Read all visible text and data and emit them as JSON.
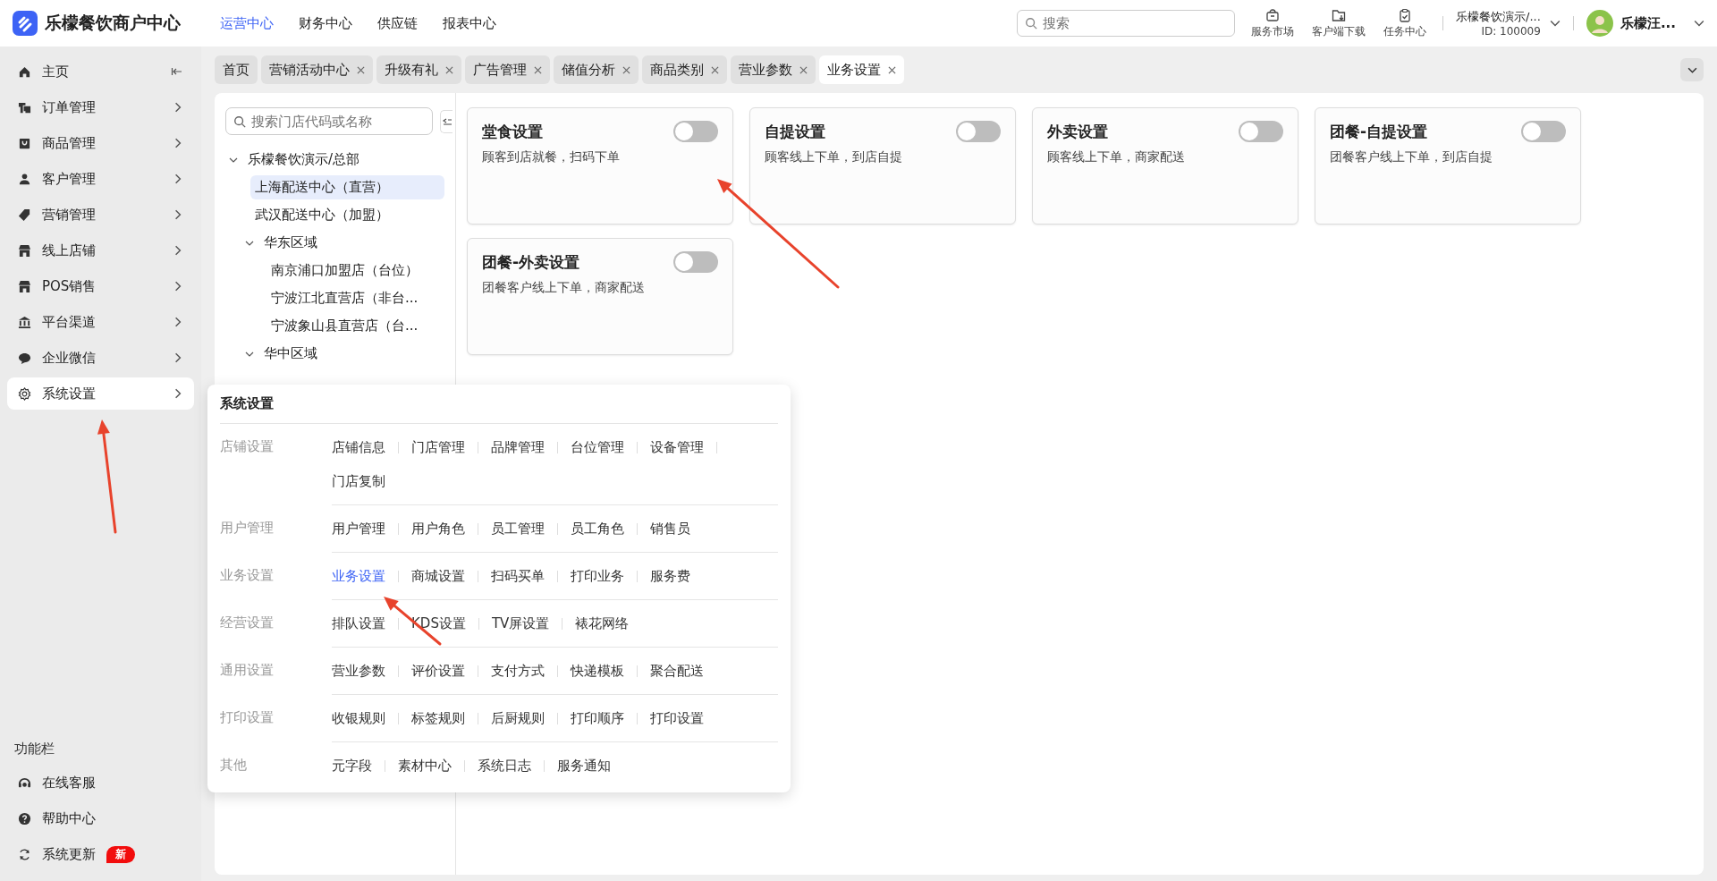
{
  "app": {
    "title": "乐檬餐饮商户中心"
  },
  "top_nav": [
    {
      "label": "运营中心",
      "selected": true
    },
    {
      "label": "财务中心",
      "selected": false
    },
    {
      "label": "供应链",
      "selected": false
    },
    {
      "label": "报表中心",
      "selected": false
    }
  ],
  "search": {
    "placeholder": "搜索"
  },
  "toolbar": [
    {
      "label": "服务市场",
      "kind": "market"
    },
    {
      "label": "客户端下载",
      "kind": "download"
    },
    {
      "label": "任务中心",
      "kind": "tasks"
    }
  ],
  "org": {
    "name": "乐檬餐饮演示/...",
    "id": "ID: 100009"
  },
  "user": {
    "name": "乐檬汪..."
  },
  "sidebar": {
    "items": [
      {
        "label": "主页",
        "selected": false,
        "kind": "collapse"
      },
      {
        "label": "订单管理",
        "selected": false,
        "kind": "menu"
      },
      {
        "label": "商品管理",
        "selected": false,
        "kind": "menu"
      },
      {
        "label": "客户管理",
        "selected": false,
        "kind": "menu"
      },
      {
        "label": "营销管理",
        "selected": false,
        "kind": "menu"
      },
      {
        "label": "线上店铺",
        "selected": false,
        "kind": "menu"
      },
      {
        "label": "POS销售",
        "selected": false,
        "kind": "menu"
      },
      {
        "label": "平台渠道",
        "selected": false,
        "kind": "menu"
      },
      {
        "label": "企业微信",
        "selected": false,
        "kind": "menu"
      },
      {
        "label": "系统设置",
        "selected": true,
        "kind": "menu"
      }
    ]
  },
  "function_bar": {
    "title": "功能栏",
    "items": [
      {
        "label": "在线客服"
      },
      {
        "label": "帮助中心"
      },
      {
        "label": "系统更新",
        "badge": "新"
      }
    ]
  },
  "tabs": [
    {
      "label": "首页",
      "selected": false,
      "closable": false
    },
    {
      "label": "营销活动中心",
      "selected": false,
      "closable": true
    },
    {
      "label": "升级有礼",
      "selected": false,
      "closable": true
    },
    {
      "label": "广告管理",
      "selected": false,
      "closable": true
    },
    {
      "label": "储值分析",
      "selected": false,
      "closable": true
    },
    {
      "label": "商品类别",
      "selected": false,
      "closable": true
    },
    {
      "label": "营业参数",
      "selected": false,
      "closable": true
    },
    {
      "label": "业务设置",
      "selected": true,
      "closable": true
    }
  ],
  "tree": {
    "placeholder": "搜索门店代码或名称",
    "nodes": [
      {
        "label": "乐檬餐饮演示/总部",
        "expanded": true,
        "selected": false,
        "children": [
          {
            "label": "上海配送中心（直营）",
            "selected": true
          },
          {
            "label": "武汉配送中心（加盟）",
            "selected": false
          },
          {
            "label": "华东区域",
            "expanded": true,
            "selected": false,
            "children": [
              {
                "label": "南京浦口加盟店（台位）",
                "selected": false
              },
              {
                "label": "宁波江北直营店（非台...",
                "selected": false
              },
              {
                "label": "宁波象山县直营店（台...",
                "selected": false
              }
            ]
          },
          {
            "label": "华中区域",
            "expanded": true,
            "selected": false
          }
        ]
      }
    ]
  },
  "cards": [
    {
      "title": "堂食设置",
      "description": "顾客到店就餐，扫码下单",
      "on": false
    },
    {
      "title": "自提设置",
      "description": "顾客线上下单，到店自提",
      "on": false
    },
    {
      "title": "外卖设置",
      "description": "顾客线上下单，商家配送",
      "on": false
    },
    {
      "title": "团餐-自提设置",
      "description": "团餐客户线上下单，到店自提",
      "on": false
    },
    {
      "title": "团餐-外卖设置",
      "description": "团餐客户线上下单，商家配送",
      "on": false
    }
  ],
  "popup": {
    "title": "系统设置",
    "groups": [
      {
        "label": "店铺设置",
        "items": [
          {
            "label": "店铺信息",
            "selected": false
          },
          {
            "label": "门店管理",
            "selected": false
          },
          {
            "label": "品牌管理",
            "selected": false
          },
          {
            "label": "台位管理",
            "selected": false
          },
          {
            "label": "设备管理",
            "selected": false
          },
          {
            "label": "门店复制",
            "selected": false
          }
        ]
      },
      {
        "label": "用户管理",
        "items": [
          {
            "label": "用户管理",
            "selected": false
          },
          {
            "label": "用户角色",
            "selected": false
          },
          {
            "label": "员工管理",
            "selected": false
          },
          {
            "label": "员工角色",
            "selected": false
          },
          {
            "label": "销售员",
            "selected": false
          }
        ]
      },
      {
        "label": "业务设置",
        "items": [
          {
            "label": "业务设置",
            "selected": true
          },
          {
            "label": "商城设置",
            "selected": false
          },
          {
            "label": "扫码买单",
            "selected": false
          },
          {
            "label": "打印业务",
            "selected": false
          },
          {
            "label": "服务费",
            "selected": false
          }
        ]
      },
      {
        "label": "经营设置",
        "items": [
          {
            "label": "排队设置",
            "selected": false
          },
          {
            "label": "KDS设置",
            "selected": false
          },
          {
            "label": "TV屏设置",
            "selected": false
          },
          {
            "label": "裱花网络",
            "selected": false
          }
        ]
      },
      {
        "label": "通用设置",
        "items": [
          {
            "label": "营业参数",
            "selected": false
          },
          {
            "label": "评价设置",
            "selected": false
          },
          {
            "label": "支付方式",
            "selected": false
          },
          {
            "label": "快递模板",
            "selected": false
          },
          {
            "label": "聚合配送",
            "selected": false
          }
        ]
      },
      {
        "label": "打印设置",
        "items": [
          {
            "label": "收银规则",
            "selected": false
          },
          {
            "label": "标签规则",
            "selected": false
          },
          {
            "label": "后厨规则",
            "selected": false
          },
          {
            "label": "打印顺序",
            "selected": false
          },
          {
            "label": "打印设置",
            "selected": false
          }
        ]
      },
      {
        "label": "其他",
        "items": [
          {
            "label": "元字段",
            "selected": false
          },
          {
            "label": "素材中心",
            "selected": false
          },
          {
            "label": "系统日志",
            "selected": false
          },
          {
            "label": "服务通知",
            "selected": false
          }
        ]
      }
    ]
  }
}
